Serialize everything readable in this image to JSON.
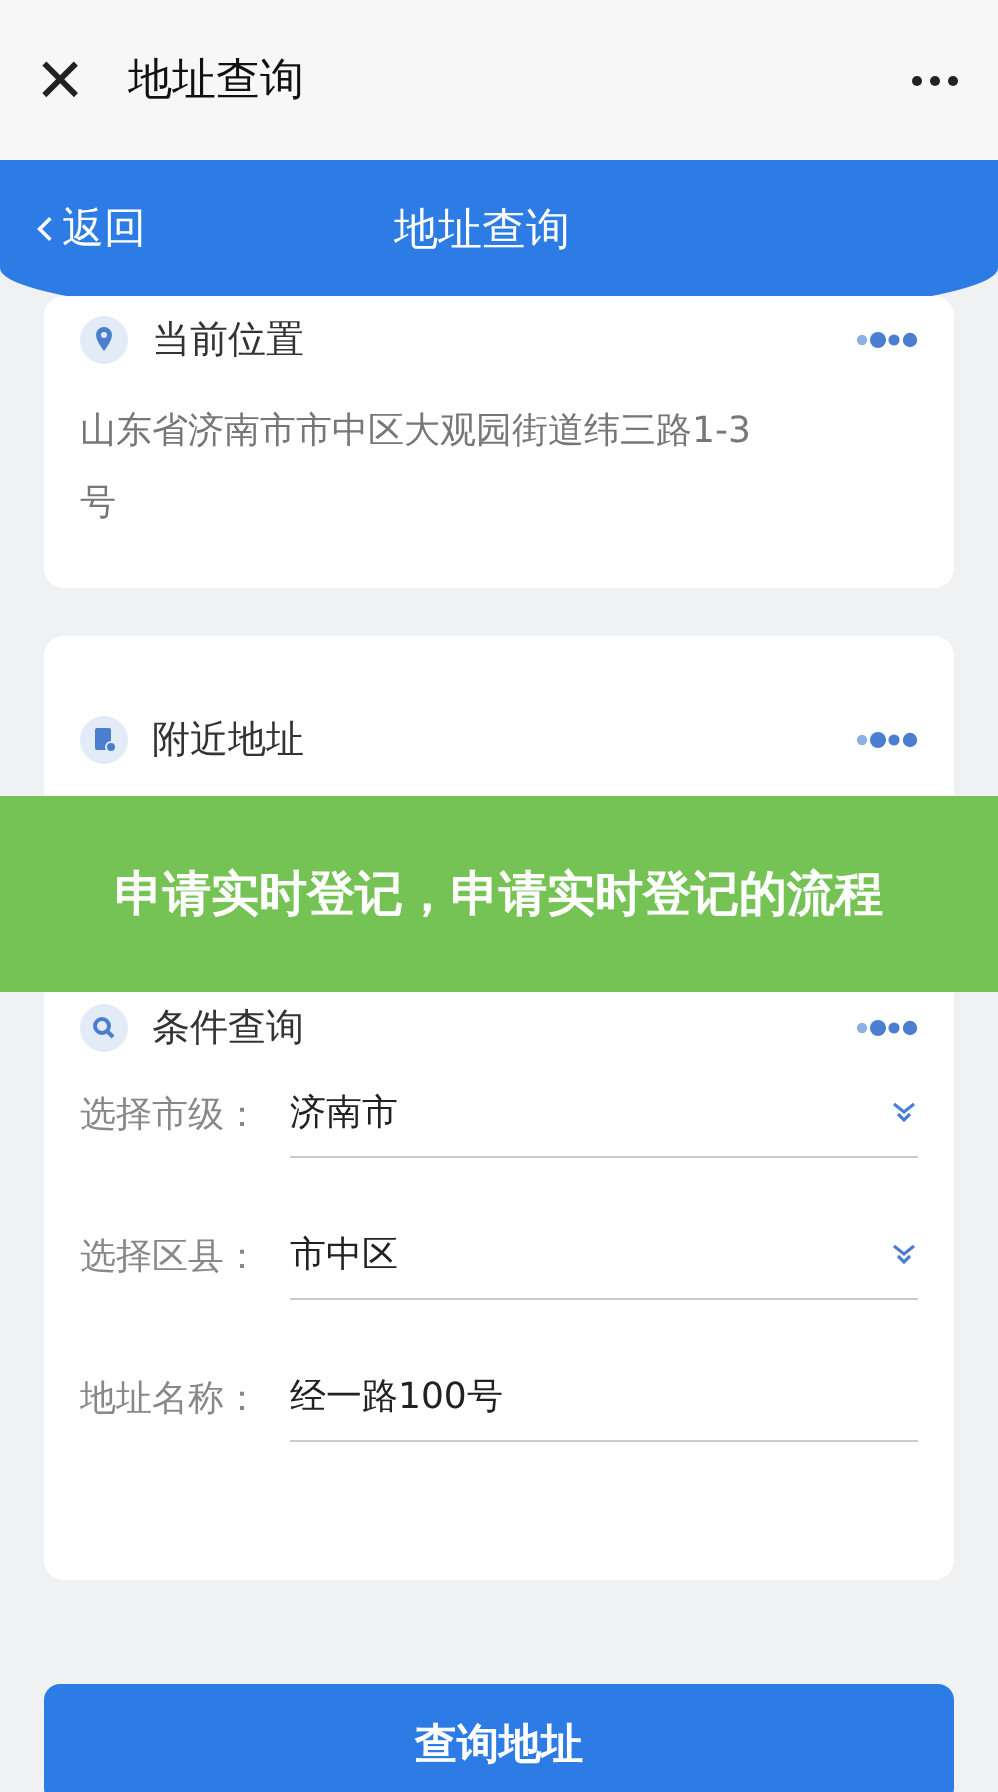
{
  "top_bar": {
    "close": "×",
    "title": "地址查询"
  },
  "header": {
    "back": "返回",
    "title": "地址查询"
  },
  "cards": [
    {
      "kind": "location",
      "title": "当前位置",
      "text": "山东省济南市市中区大观园街道纬三路1-3号"
    },
    {
      "kind": "nearby",
      "title": "附近地址"
    },
    {
      "kind": "query",
      "title": "条件查询",
      "fields": [
        {
          "label": "选择市级：",
          "value": "济南市",
          "kind": "select"
        },
        {
          "label": "选择区县：",
          "value": "市中区",
          "kind": "select"
        },
        {
          "label": "地址名称：",
          "value": "经一路100号",
          "kind": "text"
        }
      ]
    }
  ],
  "submit": "查询地址",
  "banner": "申请实时登记，申请实时登记的流程"
}
